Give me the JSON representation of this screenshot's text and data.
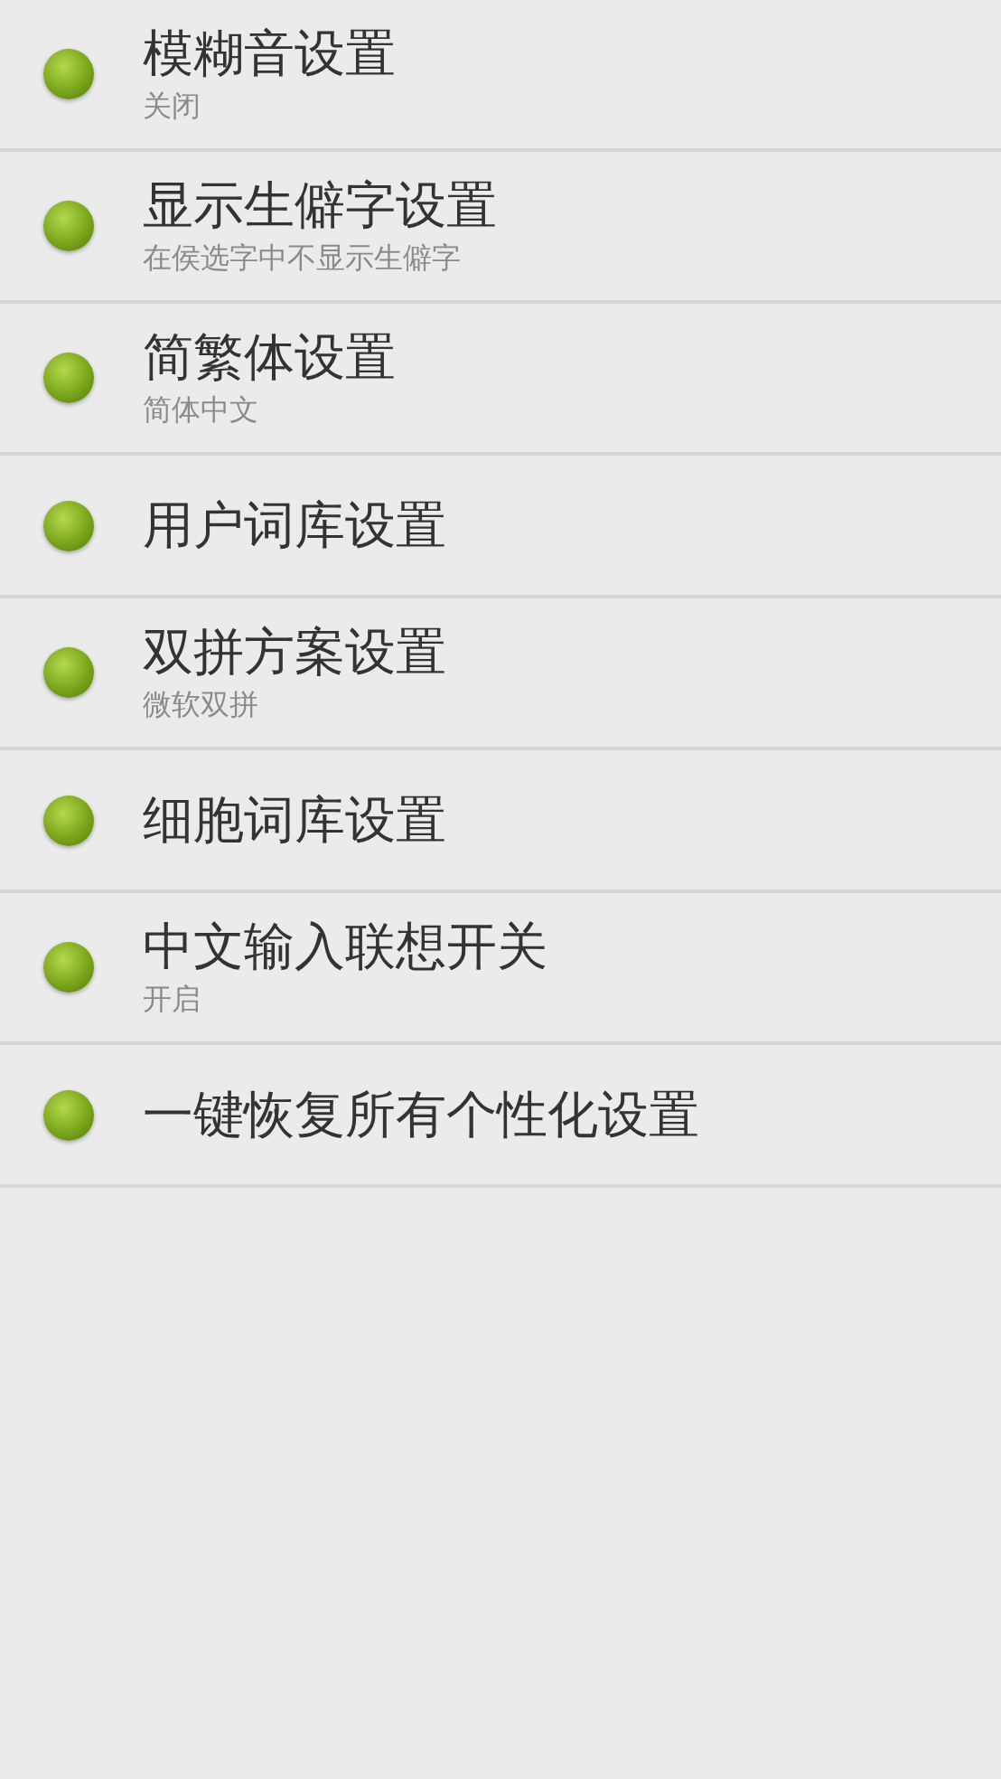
{
  "settings": [
    {
      "title": "模糊音设置",
      "subtitle": "关闭"
    },
    {
      "title": "显示生僻字设置",
      "subtitle": "在侯选字中不显示生僻字"
    },
    {
      "title": "简繁体设置",
      "subtitle": "简体中文"
    },
    {
      "title": "用户词库设置"
    },
    {
      "title": "双拼方案设置",
      "subtitle": "微软双拼"
    },
    {
      "title": "细胞词库设置"
    },
    {
      "title": "中文输入联想开关",
      "subtitle": "开启"
    },
    {
      "title": "一键恢复所有个性化设置"
    }
  ]
}
